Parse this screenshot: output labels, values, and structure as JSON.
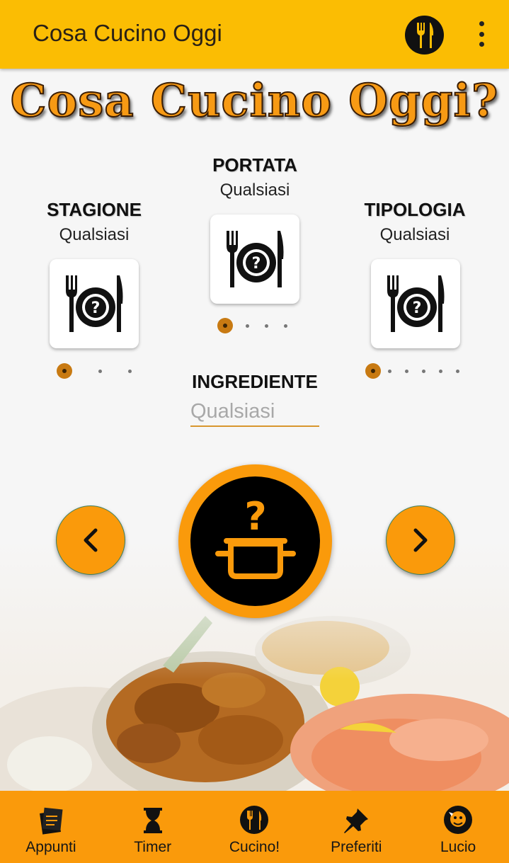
{
  "appbar": {
    "title": "Cosa Cucino Oggi"
  },
  "hero_title": "Cosa Cucino Oggi?",
  "stagione": {
    "label": "STAGIONE",
    "value": "Qualsiasi"
  },
  "portata": {
    "label": "PORTATA",
    "value": "Qualsiasi"
  },
  "tipologia": {
    "label": "TIPOLOGIA",
    "value": "Qualsiasi"
  },
  "ingrediente": {
    "label": "INGREDIENTE",
    "placeholder": "Qualsiasi"
  },
  "bottom_nav": [
    {
      "label": "Appunti",
      "icon": "notes-icon"
    },
    {
      "label": "Timer",
      "icon": "hourglass-icon"
    },
    {
      "label": "Cucino!",
      "icon": "fork-knife-icon"
    },
    {
      "label": "Preferiti",
      "icon": "pin-icon"
    },
    {
      "label": "Lucio",
      "icon": "avatar-icon"
    }
  ],
  "colors": {
    "appbar": "#fbbd03",
    "accent": "#fa9a0b",
    "title_text": "#f79a14"
  }
}
